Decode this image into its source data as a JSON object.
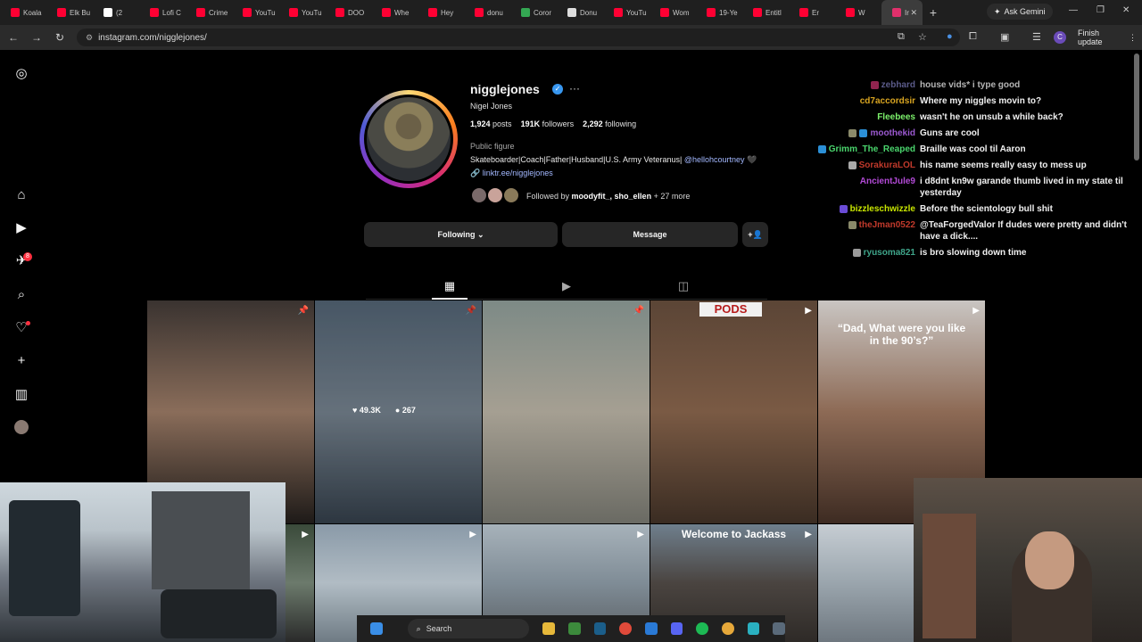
{
  "browser": {
    "tabs": [
      {
        "label": "Koala",
        "icon": "youtube-icon",
        "color": "#ff0033"
      },
      {
        "label": "Elk Bu",
        "icon": "youtube-icon",
        "color": "#ff0033"
      },
      {
        "label": "(2",
        "icon": "x-icon",
        "color": "#ffffff"
      },
      {
        "label": "Lofi C",
        "icon": "youtube-icon",
        "color": "#ff0033"
      },
      {
        "label": "Crime",
        "icon": "youtube-icon",
        "color": "#ff0033"
      },
      {
        "label": "YouTu",
        "icon": "youtube-icon",
        "color": "#ff0033"
      },
      {
        "label": "YouTu",
        "icon": "youtube-icon",
        "color": "#ff0033"
      },
      {
        "label": "DOO",
        "icon": "youtube-icon",
        "color": "#ff0033"
      },
      {
        "label": "Whe",
        "icon": "youtube-icon",
        "color": "#ff0033"
      },
      {
        "label": "Hey",
        "icon": "youtube-icon",
        "color": "#ff0033"
      },
      {
        "label": "donu",
        "icon": "youtube-icon",
        "color": "#ff0033"
      },
      {
        "label": "Coror",
        "icon": "maps-icon",
        "color": "#34a853"
      },
      {
        "label": "Donu",
        "icon": "google-icon",
        "color": "#dddddd"
      },
      {
        "label": "YouTu",
        "icon": "youtube-icon",
        "color": "#ff0033"
      },
      {
        "label": "Wom",
        "icon": "youtube-icon",
        "color": "#ff0033"
      },
      {
        "label": "19-Ye",
        "icon": "youtube-icon",
        "color": "#ff0033"
      },
      {
        "label": "Entitl",
        "icon": "youtube-icon",
        "color": "#ff0033"
      },
      {
        "label": "Er",
        "icon": "youtube-icon",
        "color": "#ff0033"
      },
      {
        "label": "W",
        "icon": "youtube-icon",
        "color": "#ff0033"
      }
    ],
    "active_tab": {
      "label": "Ir",
      "icon": "instagram-icon",
      "color": "#e1306c"
    },
    "new_tab": "+",
    "gemini_label": "Ask Gemini",
    "url": "instagram.com/nigglejones/",
    "finish_update": "Finish update",
    "profile_initial": "C"
  },
  "sidebar": {
    "notifications_badge": "8"
  },
  "profile": {
    "username": "nigglejones",
    "verified_mark": "✓",
    "options": "···",
    "full_name": "Nigel Jones",
    "posts_count": "1,924",
    "posts_label": "posts",
    "followers_count": "191K",
    "followers_label": "followers",
    "following_count": "2,292",
    "following_label": "following",
    "category": "Public figure",
    "bio_text": "Skateboarder|Coach|Father|Husband|U.S. Army Veteranus|",
    "bio_mention": "@hellohcourtney",
    "bio_heart": "🖤",
    "link": "linktr.ee/nigglejones",
    "followed_by_prefix": "Followed by",
    "followed_by_names": "moodyfit_, sho_ellen",
    "followed_by_more": "+ 27 more",
    "following_button": "Following ⌄",
    "message_button": "Message",
    "add_person_icon": "+👤"
  },
  "posts": [
    {
      "caption": "",
      "pinned": true,
      "colors": [
        "#3a3330",
        "#8a6d5a",
        "#1e1a18"
      ]
    },
    {
      "caption": "",
      "pinned": true,
      "likes": "49.3K",
      "comments": "267",
      "colors": [
        "#5f7386",
        "#8796a4",
        "#3b4855"
      ]
    },
    {
      "caption": "",
      "pinned": true,
      "colors": [
        "#7d8a86",
        "#a59f92",
        "#6a6a63"
      ]
    },
    {
      "caption": "PODS",
      "pinned": false,
      "colors": [
        "#5b4536",
        "#7a5a44",
        "#3a2c22"
      ]
    },
    {
      "caption": "“Dad, What were you like in the 90’s?”",
      "pinned": false,
      "colors": [
        "#c9c5c2",
        "#8d6a55",
        "#3d2b22"
      ]
    },
    {
      "caption": "",
      "pinned": false,
      "colors": [
        "#3a4a3a",
        "#6c7a6c",
        "#2a2a2a"
      ]
    },
    {
      "caption": "",
      "pinned": false,
      "colors": [
        "#8a9aa8",
        "#b1bcc4",
        "#6f7b84"
      ]
    },
    {
      "caption": "",
      "pinned": false,
      "colors": [
        "#a7b2ba",
        "#7f8c96",
        "#5a5f63"
      ]
    },
    {
      "caption": "Welcome to Jackass",
      "pinned": false,
      "colors": [
        "#6f7f8d",
        "#4a4440",
        "#2e2a27"
      ]
    },
    {
      "caption": "",
      "pinned": false,
      "colors": [
        "#c6cdd3",
        "#9aa5ad",
        "#6e777f"
      ]
    }
  ],
  "chat": [
    {
      "user": "zebhard",
      "color": "#7a7ab8",
      "emotes": [
        "#c0306a"
      ],
      "msg": "house vids* i type good",
      "dim": true
    },
    {
      "user": "cd7accordsir",
      "color": "#d9a521",
      "emotes": [],
      "msg": "Where my niggles movin to?"
    },
    {
      "user": "Fleebees",
      "color": "#7cf06b",
      "emotes": [],
      "msg": "wasn't he on unsub a while back?"
    },
    {
      "user": "moothekid",
      "color": "#9b59d0",
      "emotes": [
        "#8a8a6a",
        "#2b8fd6"
      ],
      "msg": "Guns are cool"
    },
    {
      "user": "Grimm_The_Reaped",
      "color": "#4ad66d",
      "emotes": [
        "#2b8fd6"
      ],
      "msg": "Braille was cool til Aaron"
    },
    {
      "user": "SorakuraLOL",
      "color": "#c0392b",
      "emotes": [
        "#aaaaaa"
      ],
      "msg": "his name seems really easy to mess up"
    },
    {
      "user": "AncientJule9",
      "color": "#b24ad6",
      "emotes": [],
      "msg": "i d8dnt kn9w garande thumb lived in my state til yesterday"
    },
    {
      "user": "bizzleschwizzle",
      "color": "#c8e600",
      "emotes": [
        "#6a4bd6"
      ],
      "msg": "Before the scientology bull shit"
    },
    {
      "user": "theJman0522",
      "color": "#c0392b",
      "emotes": [
        "#8a8a6a"
      ],
      "msg": "@TeaForgedValor If dudes were pretty and didn't have a dick...."
    },
    {
      "user": "ryusoma821",
      "color": "#3fa58a",
      "emotes": [
        "#9a9a9a"
      ],
      "msg": "is bro slowing down time"
    }
  ],
  "taskbar": {
    "search_label": "Search"
  }
}
